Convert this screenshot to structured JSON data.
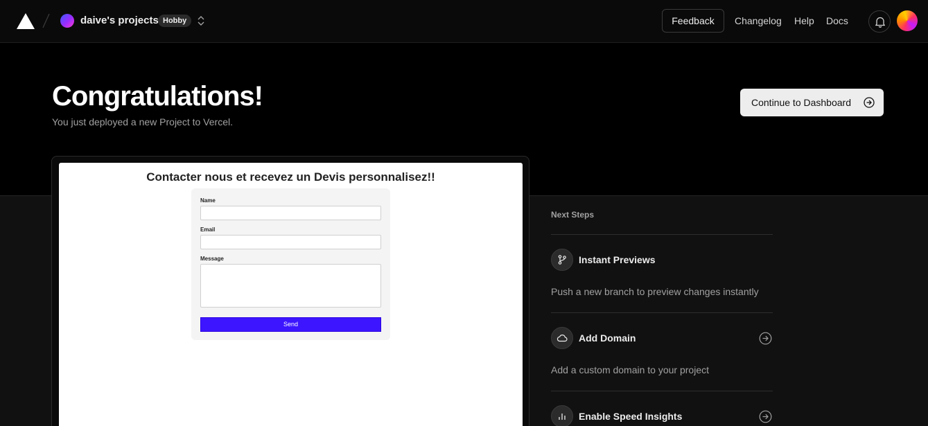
{
  "topnav": {
    "team_name": "daive's projects",
    "plan_badge": "Hobby",
    "feedback_label": "Feedback",
    "links": [
      "Changelog",
      "Help",
      "Docs"
    ]
  },
  "hero": {
    "title": "Congratulations!",
    "subtitle": "You just deployed a new Project to Vercel.",
    "continue_label": "Continue to Dashboard"
  },
  "preview": {
    "title": "Contacter nous et recevez un Devis personnalisez!!",
    "fields": [
      "Name",
      "Email",
      "Message"
    ],
    "send_label": "Send"
  },
  "next_steps": {
    "heading": "Next Steps",
    "items": [
      {
        "title": "Instant Previews",
        "description": "Push a new branch to preview changes instantly",
        "icon": "git-branch-icon"
      },
      {
        "title": "Add Domain",
        "description": "Add a custom domain to your project",
        "icon": "cloud-icon"
      },
      {
        "title": "Enable Speed Insights",
        "icon": "bar-chart-icon"
      }
    ]
  },
  "colors": {
    "background": "#000000",
    "accent_button": "#ededed",
    "form_send": "#3d16ff"
  }
}
